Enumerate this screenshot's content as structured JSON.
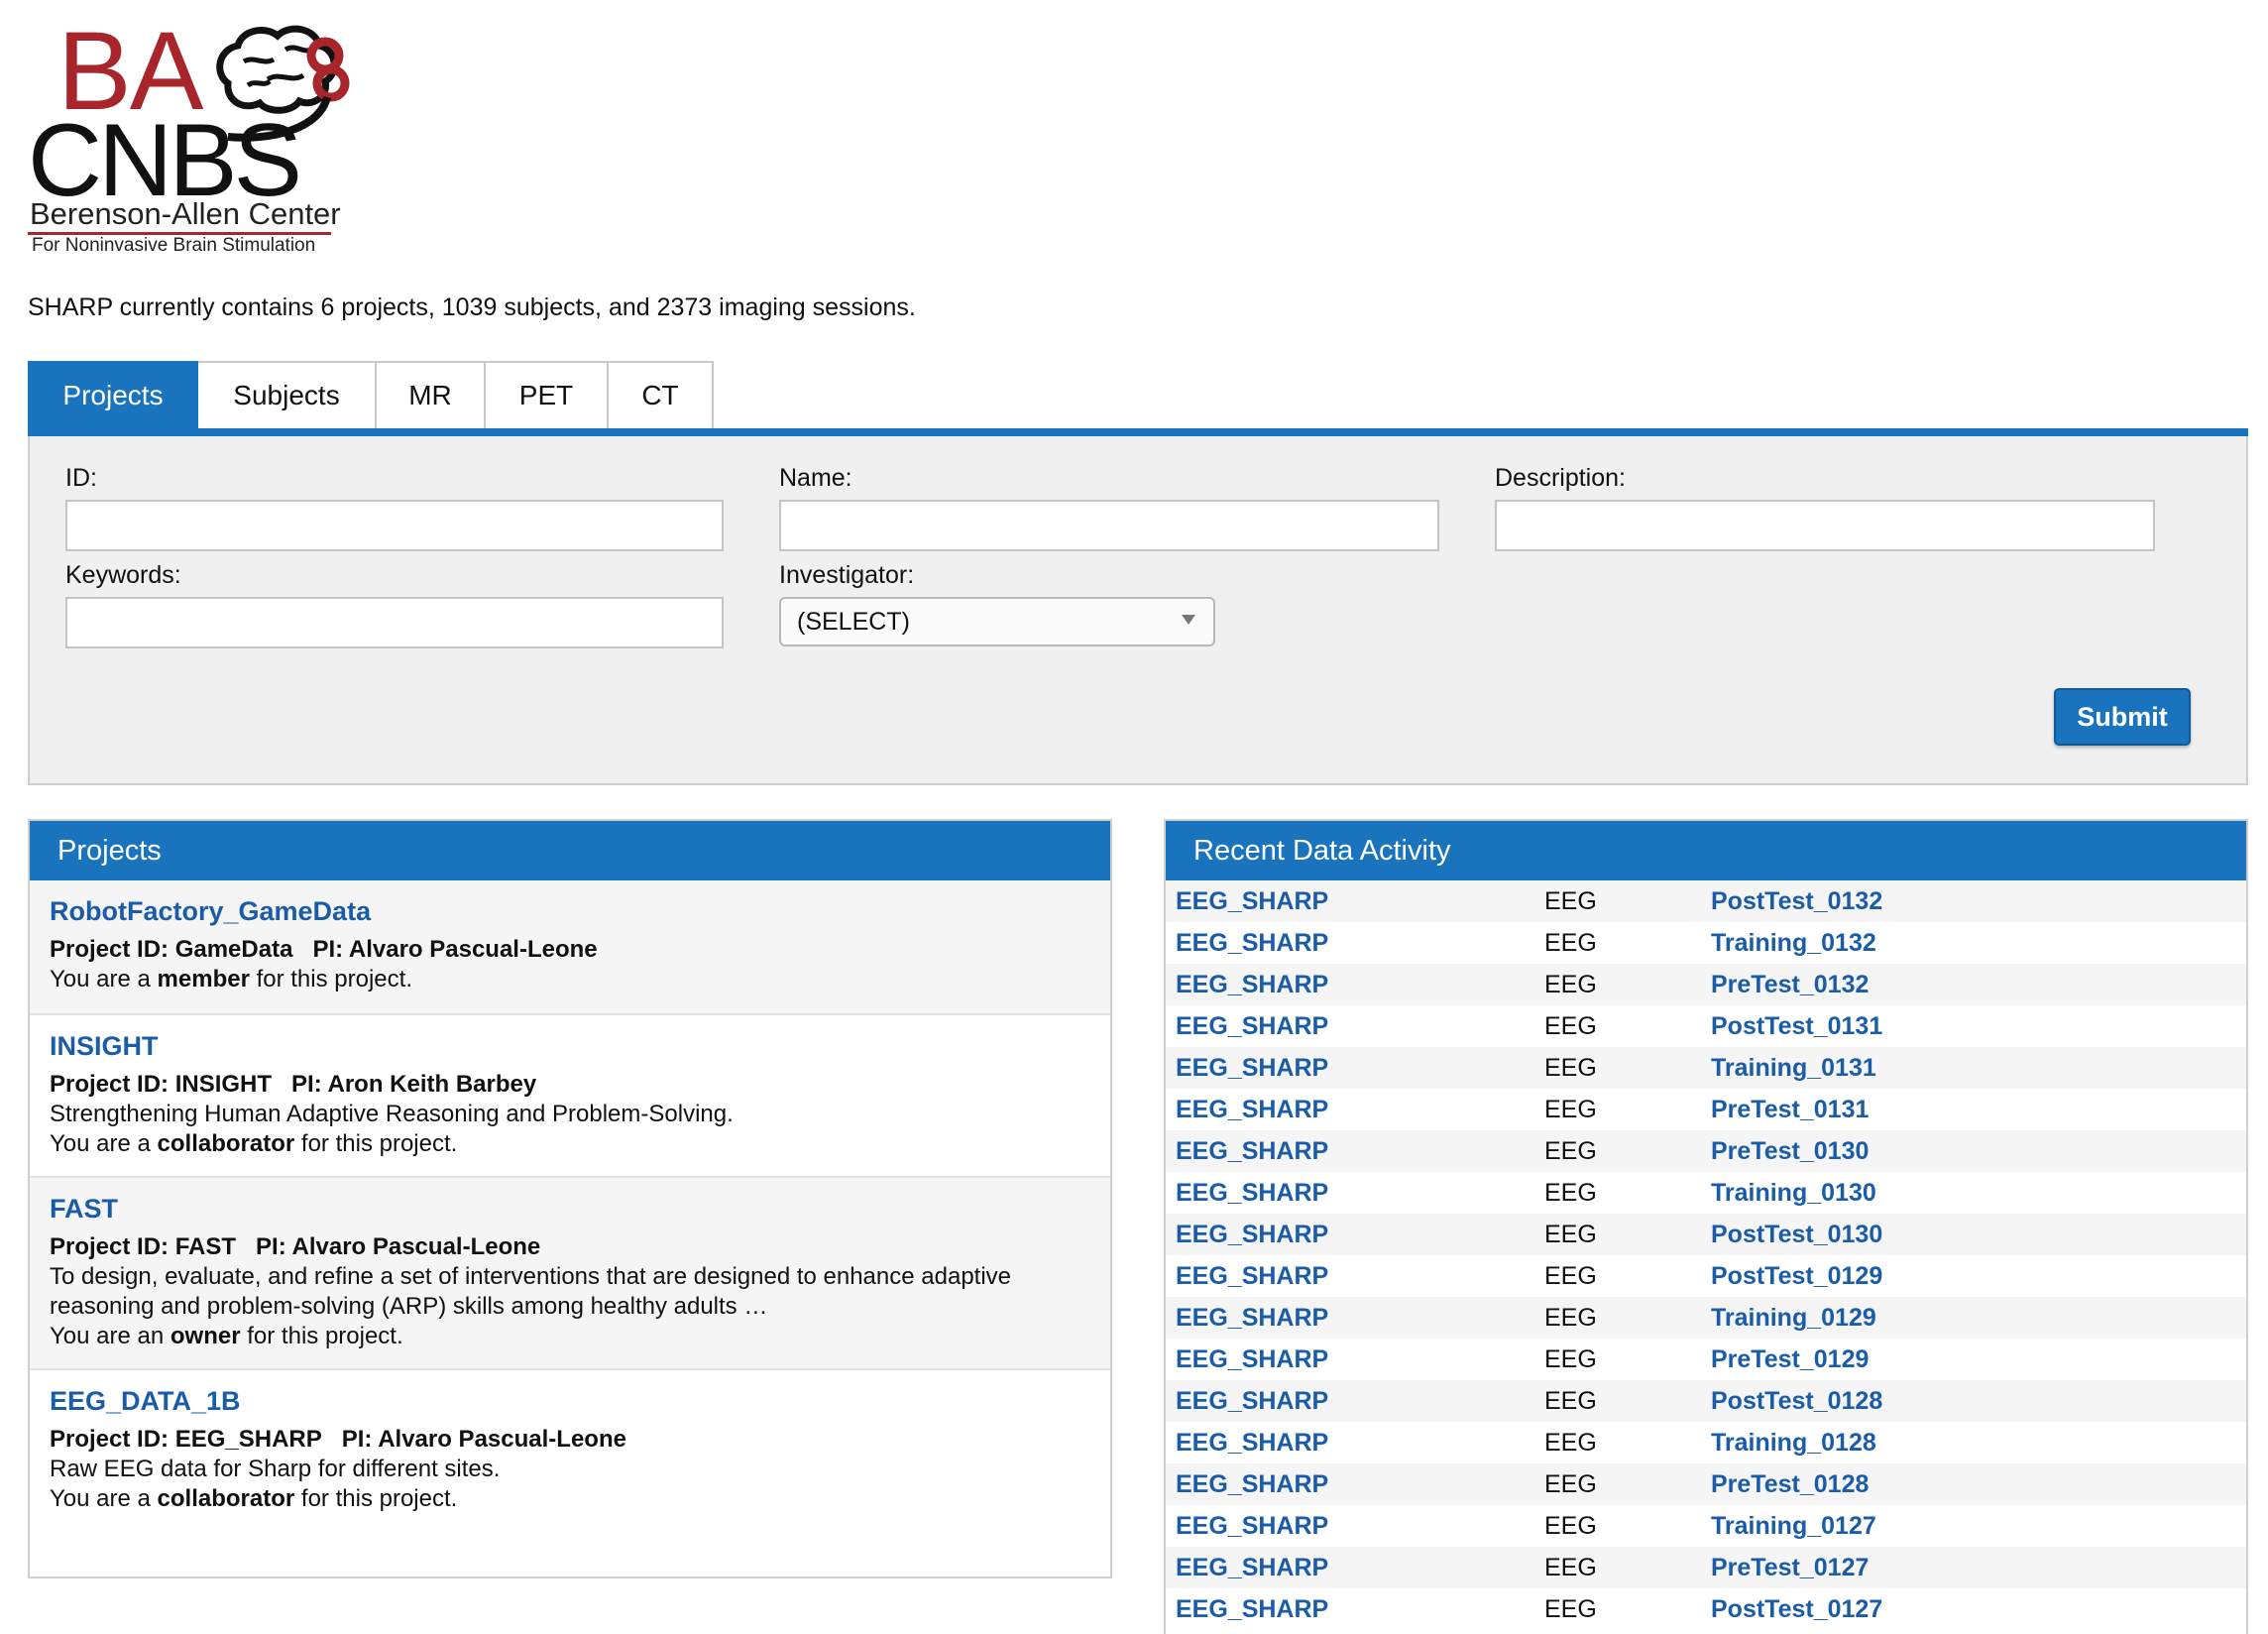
{
  "logo": {
    "line_ba": "BA",
    "line_cnbs": "CNBS",
    "line_center": "Berenson-Allen Center",
    "line_tagline": "For Noninvasive Brain Stimulation"
  },
  "summary": "SHARP currently contains 6 projects, 1039 subjects, and 2373 imaging sessions.",
  "tabs": [
    "Projects",
    "Subjects",
    "MR",
    "PET",
    "CT"
  ],
  "search": {
    "id_label": "ID:",
    "name_label": "Name:",
    "description_label": "Description:",
    "keywords_label": "Keywords:",
    "investigator_label": "Investigator:",
    "investigator_value": "(SELECT)",
    "submit_label": "Submit"
  },
  "projects_panel": {
    "title": "Projects",
    "items": [
      {
        "name": "RobotFactory_GameData",
        "id_label": "Project ID: GameData",
        "pi_label": "PI: Alvaro Pascual-Leone",
        "description": "",
        "role_prefix": "You are a ",
        "role": "member",
        "role_suffix": " for this project."
      },
      {
        "name": "INSIGHT",
        "id_label": "Project ID: INSIGHT",
        "pi_label": "PI: Aron Keith Barbey",
        "description": "Strengthening Human Adaptive Reasoning and Problem-Solving.",
        "role_prefix": "You are a ",
        "role": "collaborator",
        "role_suffix": " for this project."
      },
      {
        "name": "FAST",
        "id_label": "Project ID: FAST",
        "pi_label": "PI: Alvaro Pascual-Leone",
        "description": "To design, evaluate, and refine a set of interventions that are designed to enhance adaptive reasoning and problem-solving (ARP) skills among healthy adults  …",
        "role_prefix": "You are an ",
        "role": "owner",
        "role_suffix": " for this project."
      },
      {
        "name": "EEG_DATA_1B",
        "id_label": "Project ID: EEG_SHARP",
        "pi_label": "PI: Alvaro Pascual-Leone",
        "description": "Raw EEG data for Sharp for different sites.",
        "role_prefix": "You are a ",
        "role": "collaborator",
        "role_suffix": " for this project."
      }
    ]
  },
  "activity_panel": {
    "title": "Recent Data Activity",
    "rows": [
      {
        "project": "EEG_SHARP",
        "type": "EEG",
        "session": "PostTest_0132"
      },
      {
        "project": "EEG_SHARP",
        "type": "EEG",
        "session": "Training_0132"
      },
      {
        "project": "EEG_SHARP",
        "type": "EEG",
        "session": "PreTest_0132"
      },
      {
        "project": "EEG_SHARP",
        "type": "EEG",
        "session": "PostTest_0131"
      },
      {
        "project": "EEG_SHARP",
        "type": "EEG",
        "session": "Training_0131"
      },
      {
        "project": "EEG_SHARP",
        "type": "EEG",
        "session": "PreTest_0131"
      },
      {
        "project": "EEG_SHARP",
        "type": "EEG",
        "session": "PreTest_0130"
      },
      {
        "project": "EEG_SHARP",
        "type": "EEG",
        "session": "Training_0130"
      },
      {
        "project": "EEG_SHARP",
        "type": "EEG",
        "session": "PostTest_0130"
      },
      {
        "project": "EEG_SHARP",
        "type": "EEG",
        "session": "PostTest_0129"
      },
      {
        "project": "EEG_SHARP",
        "type": "EEG",
        "session": "Training_0129"
      },
      {
        "project": "EEG_SHARP",
        "type": "EEG",
        "session": "PreTest_0129"
      },
      {
        "project": "EEG_SHARP",
        "type": "EEG",
        "session": "PostTest_0128"
      },
      {
        "project": "EEG_SHARP",
        "type": "EEG",
        "session": "Training_0128"
      },
      {
        "project": "EEG_SHARP",
        "type": "EEG",
        "session": "PreTest_0128"
      },
      {
        "project": "EEG_SHARP",
        "type": "EEG",
        "session": "Training_0127"
      },
      {
        "project": "EEG_SHARP",
        "type": "EEG",
        "session": "PreTest_0127"
      },
      {
        "project": "EEG_SHARP",
        "type": "EEG",
        "session": "PostTest_0127"
      }
    ]
  },
  "colors": {
    "accent": "#1a74bd",
    "link": "#1a5ca8",
    "logo_red": "#a8262b"
  }
}
